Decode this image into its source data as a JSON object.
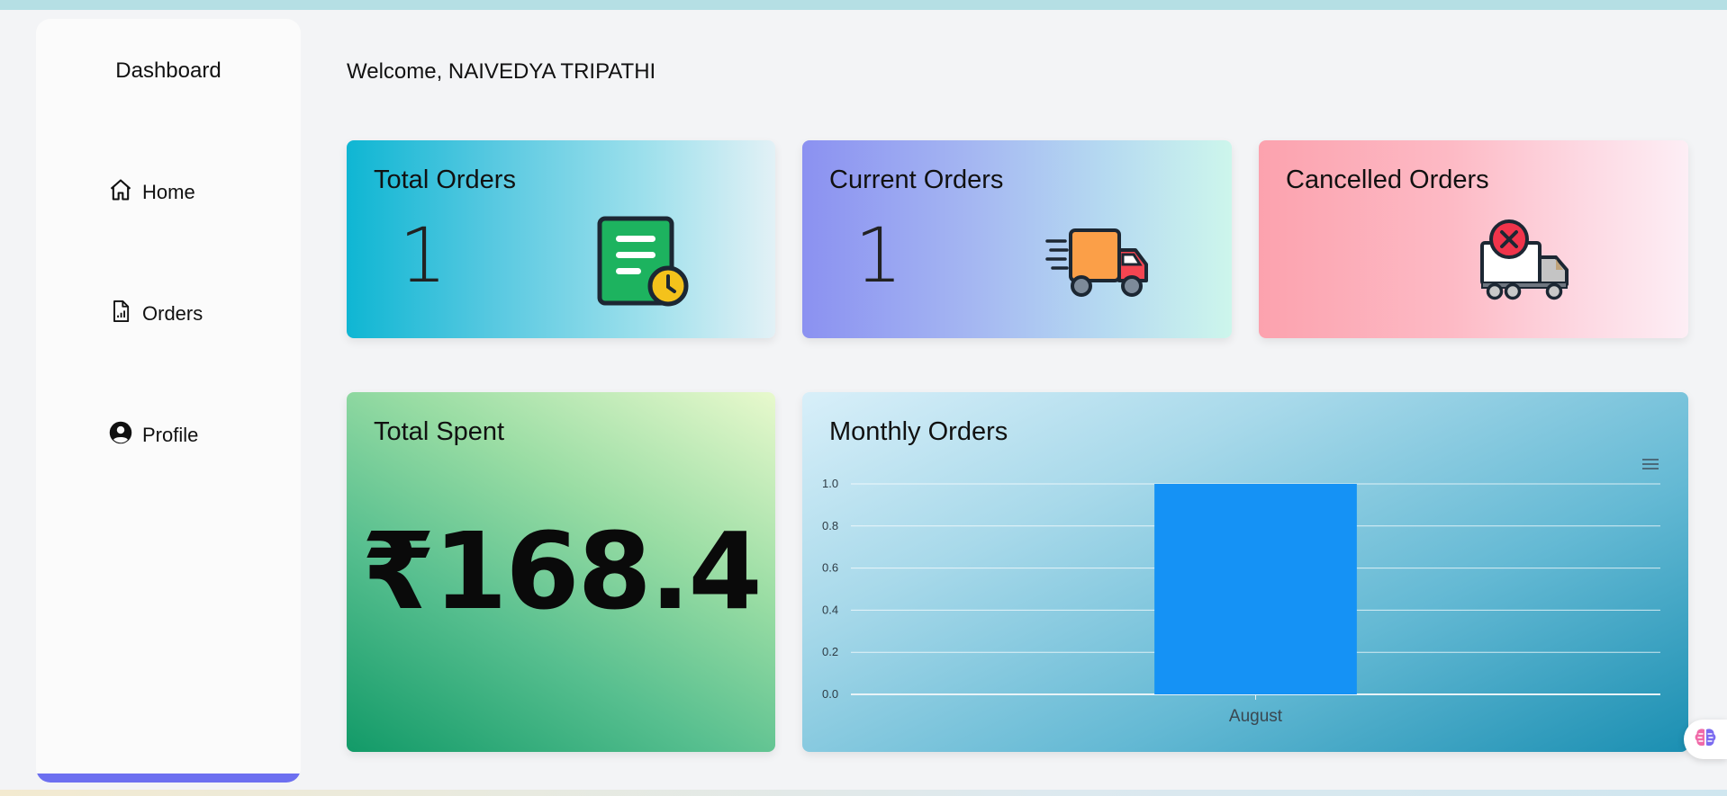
{
  "sidebar": {
    "brand": "Dashboard",
    "items": [
      {
        "label": "Home",
        "icon": "home-icon"
      },
      {
        "label": "Orders",
        "icon": "document-chart-icon"
      },
      {
        "label": "Profile",
        "icon": "user-circle-icon"
      }
    ]
  },
  "header": {
    "welcome": "Welcome, NAIVEDYA TRIPATHI"
  },
  "cards": {
    "total_orders": {
      "title": "Total Orders",
      "value": "1",
      "icon": "order-document-clock-icon"
    },
    "current_orders": {
      "title": "Current Orders",
      "value": "1",
      "icon": "delivery-truck-icon"
    },
    "cancelled_orders": {
      "title": "Cancelled Orders",
      "icon": "cancelled-truck-icon"
    },
    "total_spent": {
      "title": "Total Spent",
      "value": "₹168.4"
    },
    "monthly_orders": {
      "title": "Monthly Orders"
    }
  },
  "colors": {
    "accent": "#6c6ff0",
    "bar": "#1592f5"
  },
  "chart_data": {
    "type": "bar",
    "categories": [
      "August"
    ],
    "values": [
      1
    ],
    "xlabel": "",
    "ylabel": "",
    "ylim": [
      0,
      1.0
    ],
    "yticks": [
      "0.0",
      "0.2",
      "0.4",
      "0.6",
      "0.8",
      "1.0"
    ],
    "grid": true
  }
}
